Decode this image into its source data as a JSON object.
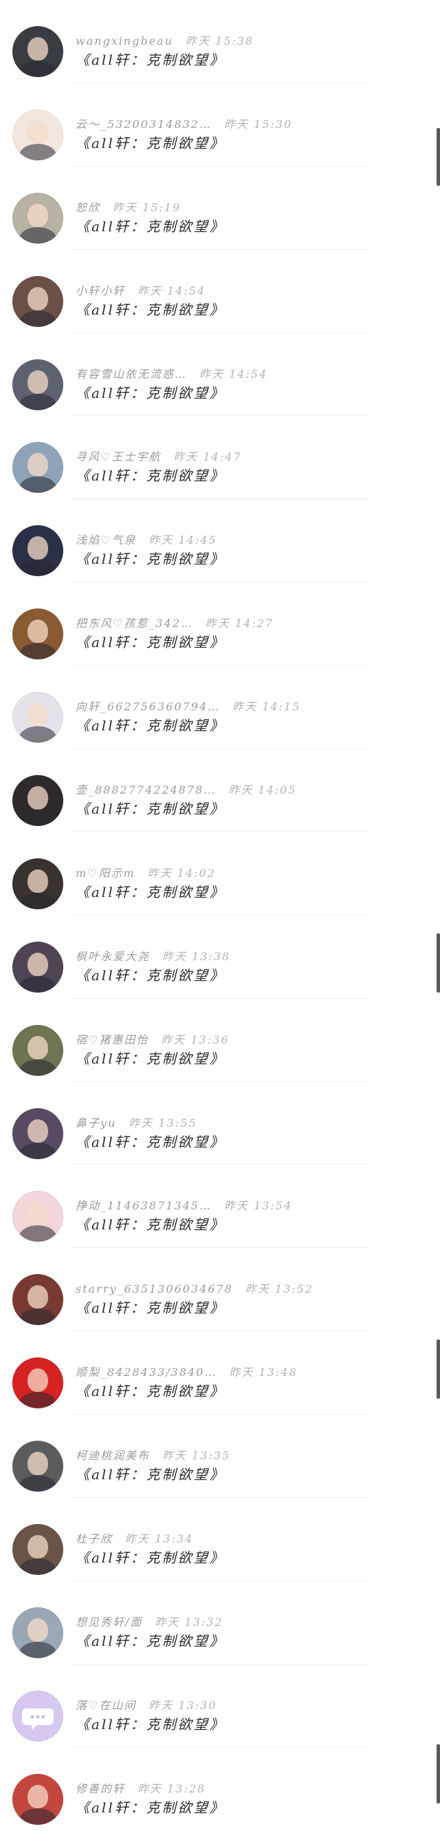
{
  "colors": {
    "background": "#ffffff",
    "username": "#9b9b9b",
    "time": "#b2b2b2",
    "comment": "#2b2b2b",
    "divider": "#eeeeee"
  },
  "comments": [
    {
      "username": "wangxingbeau",
      "time": "昨天 15:38",
      "text": "《all轩：克制欲望》",
      "avatar": {
        "bg": "#3a3c44",
        "face": true
      }
    },
    {
      "username": "云～_53200314832…",
      "time": "昨天 15:30",
      "text": "《all轩：克制欲望》",
      "avatar": {
        "bg": "#f3e6df",
        "face": true
      }
    },
    {
      "username": "恕欣",
      "time": "昨天 15:19",
      "text": "《all轩：克制欲望》",
      "avatar": {
        "bg": "#b7b2a4",
        "face": true
      }
    },
    {
      "username": "小轩小轩",
      "time": "昨天 14:54",
      "text": "《all轩：克制欲望》",
      "avatar": {
        "bg": "#6b5048",
        "face": true
      }
    },
    {
      "username": "有容雪山依无流惑…",
      "time": "昨天 14:54",
      "text": "《all轩：克制欲望》",
      "avatar": {
        "bg": "#5d6270",
        "face": true
      }
    },
    {
      "username": "寻风♡王士宇航",
      "time": "昨天 14:47",
      "text": "《all轩：克制欲望》",
      "avatar": {
        "bg": "#8fa3b8",
        "face": true
      }
    },
    {
      "username": "浅焰♡气泉",
      "time": "昨天 14:45",
      "text": "《all轩：克制欲望》",
      "avatar": {
        "bg": "#2a3048",
        "face": true
      }
    },
    {
      "username": "把东风♡孩惹_342…",
      "time": "昨天 14:27",
      "text": "《all轩：克制欲望》",
      "avatar": {
        "bg": "#8a5a32",
        "face": true
      }
    },
    {
      "username": "向轩_662756360794…",
      "time": "昨天 14:15",
      "text": "《all轩：克制欲望》",
      "avatar": {
        "bg": "#e6e2ec",
        "face": true
      }
    },
    {
      "username": "壶_8882774224878…",
      "time": "昨天 14:05",
      "text": "《all轩：克制欲望》",
      "avatar": {
        "bg": "#2e2a2c",
        "face": true
      }
    },
    {
      "username": "m♡阳示m",
      "time": "昨天 14:02",
      "text": "《all轩：克制欲望》",
      "avatar": {
        "bg": "#3a3230",
        "face": true
      }
    },
    {
      "username": "枫叶永爱大尧",
      "time": "昨天 13:38",
      "text": "《all轩：克制欲望》",
      "avatar": {
        "bg": "#4e4454",
        "face": true
      }
    },
    {
      "username": "宿♡猪惠田怡",
      "time": "昨天 13:36",
      "text": "《all轩：克制欲望》",
      "avatar": {
        "bg": "#6f7452",
        "face": true
      }
    },
    {
      "username": "鼻子yu",
      "time": "昨天 13:55",
      "text": "《all轩：克制欲望》",
      "avatar": {
        "bg": "#574a62",
        "face": true
      }
    },
    {
      "username": "挣动_11463871345…",
      "time": "昨天 13:54",
      "text": "《all轩：克制欲望》",
      "avatar": {
        "bg": "#f2d6da",
        "face": true
      }
    },
    {
      "username": "starry_6351306034678",
      "time": "昨天 13:52",
      "text": "《all轩：克制欲望》",
      "avatar": {
        "bg": "#7a3a34",
        "face": true
      }
    },
    {
      "username": "顺梨_8428433/3840…",
      "time": "昨天 13:48",
      "text": "《all轩：克制欲望》",
      "avatar": {
        "bg": "#d62222",
        "face": true
      }
    },
    {
      "username": "柯迪桃润美布",
      "time": "昨天 13:35",
      "text": "《all轩：克制欲望》",
      "avatar": {
        "bg": "#5a5c5e",
        "face": true
      }
    },
    {
      "username": "杜子欣",
      "time": "昨天 13:34",
      "text": "《all轩：克制欲望》",
      "avatar": {
        "bg": "#6a5448",
        "face": true
      }
    },
    {
      "username": "想见秀轩/面",
      "time": "昨天 13:32",
      "text": "《all轩：克制欲望》",
      "avatar": {
        "bg": "#9aa8b6",
        "face": true
      }
    },
    {
      "username": "落♡在山间",
      "time": "昨天 13:30",
      "text": "《all轩：克制欲望》",
      "avatar": {
        "bg": "#d8c7f0",
        "face": false,
        "icon": "message-bubble-icon"
      }
    },
    {
      "username": "修善的轩",
      "time": "昨天 13:28",
      "text": "《all轩：克制欲望》",
      "avatar": {
        "bg": "#c2463e",
        "face": true
      }
    }
  ]
}
